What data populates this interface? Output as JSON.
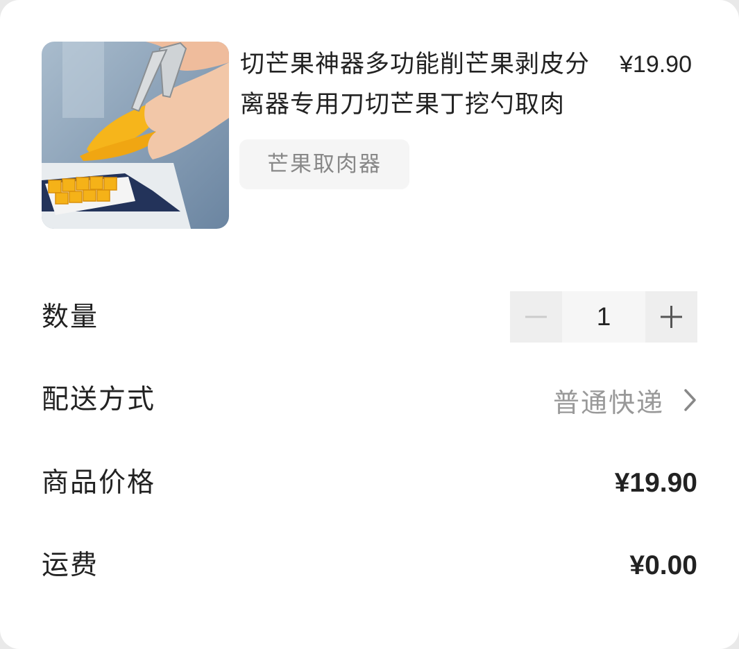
{
  "product": {
    "title": "切芒果神器多功能削芒果剥皮分离器专用刀切芒果丁挖勺取肉",
    "price": "¥19.90",
    "spec": "芒果取肉器",
    "image_icon": "product-photo-mango-slicer"
  },
  "quantity": {
    "label": "数量",
    "value": "1",
    "minus_icon": "minus-icon",
    "plus_icon": "plus-icon"
  },
  "shipping": {
    "label": "配送方式",
    "value": "普通快递",
    "icon": "chevron-right-icon"
  },
  "item_price": {
    "label": "商品价格",
    "value": "¥19.90"
  },
  "freight": {
    "label": "运费",
    "value": "¥0.00"
  },
  "colors": {
    "text": "#222222",
    "muted": "#999999",
    "tag_bg": "#f5f5f5",
    "stepper_bg": "#eeeeee"
  }
}
